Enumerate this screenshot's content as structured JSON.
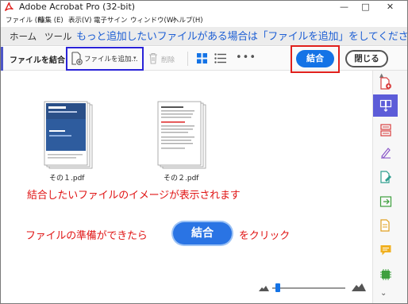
{
  "window": {
    "title": "Adobe Acrobat Pro (32-bit)",
    "controls": {
      "minimize": "—",
      "maximize": "□",
      "close": "✕"
    }
  },
  "menu": {
    "items": [
      "ファイル (F)",
      "編集 (E)",
      "表示(V)",
      "電子サイン",
      "ウィンドウ(W)",
      "ヘルプ(H)"
    ]
  },
  "tabs": [
    {
      "label": "ホーム"
    },
    {
      "label": "ツール"
    }
  ],
  "annotation_banner": "もっと追加したいファイルがある場合は「ファイルを追加」をしてください",
  "toolbar": {
    "title": "ファイルを結合",
    "add_files_label": "ファイルを追加...",
    "add_files_caret": "▾",
    "delete_label": "削除",
    "more_label": "•••",
    "combine_label": "結合",
    "close_label": "閉じる"
  },
  "files": [
    {
      "name": "その１.pdf"
    },
    {
      "name": "その２.pdf"
    }
  ],
  "annotations": {
    "preview_note": "結合したいファイルのイメージが表示されます",
    "instruction_prefix": "ファイルの準備ができたら",
    "instruction_button": "結合",
    "instruction_suffix": "をクリック"
  },
  "rail": {
    "icons": [
      "create-pdf-icon",
      "combine-files-icon",
      "organize-pages-icon",
      "fill-sign-icon",
      "edit-pdf-icon",
      "export-pdf-icon",
      "comment-icon",
      "comment-bubble-icon",
      "print-production-icon"
    ],
    "scroll_up": "▲",
    "scroll_down": "⌄"
  },
  "zoom": {
    "level_fraction": 0.08
  },
  "colors": {
    "accent_blue": "#1473e6",
    "annotation_red": "#e01515",
    "annotation_blue": "#1e5fd4",
    "rail_active": "#5c5cd8"
  }
}
